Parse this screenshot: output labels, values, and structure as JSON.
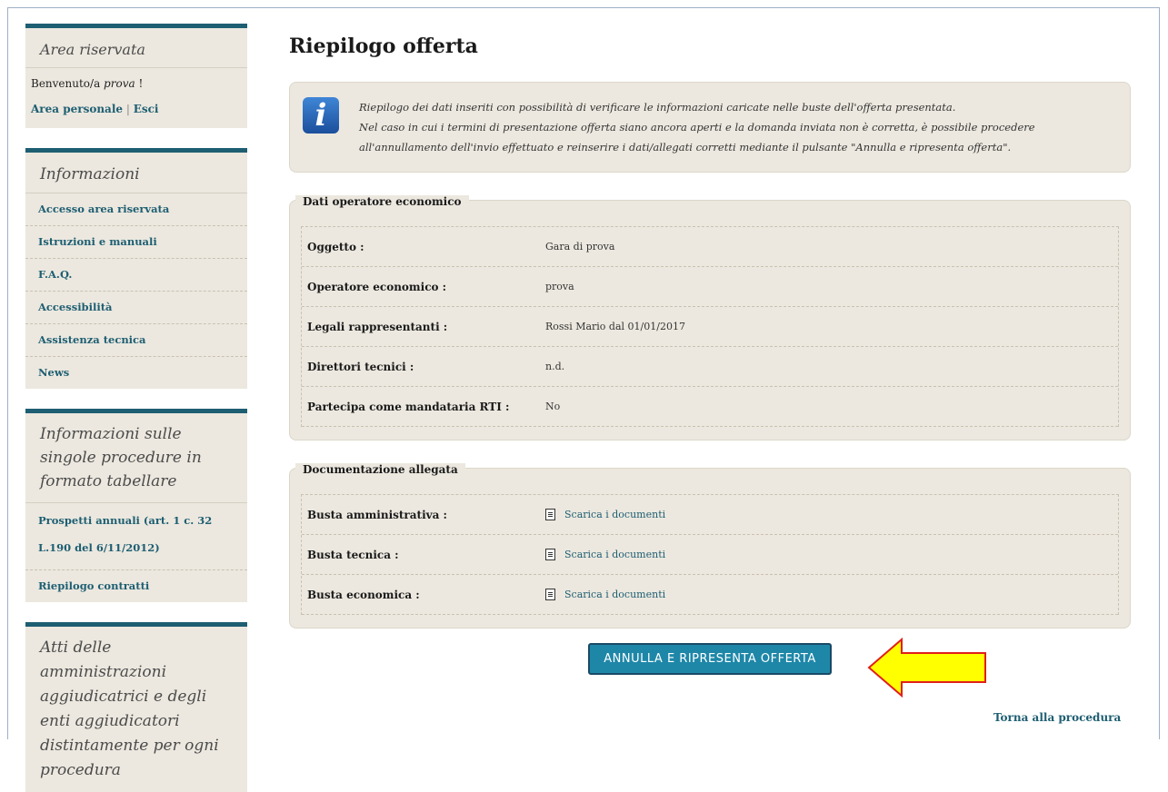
{
  "sidebar": {
    "area_title": "Area riservata",
    "welcome_prefix": "Benvenuto/a ",
    "welcome_user": "prova",
    "welcome_suffix": " !",
    "area_personale": "Area personale",
    "separator": " | ",
    "esci": "Esci",
    "info_title": "Informazioni",
    "info_items": [
      "Accesso area riservata",
      "Istruzioni e manuali",
      "F.A.Q.",
      "Accessibilità",
      "Assistenza tecnica",
      "News"
    ],
    "tabular_title": "Informazioni sulle singole procedure in formato tabellare",
    "tabular_items": [
      "Prospetti annuali (art. 1 c. 32 L.190 del 6/11/2012)",
      "Riepilogo contratti"
    ],
    "atti_title": "Atti delle amministrazioni aggiudicatrici e degli enti aggiudicatori distintamente per ogni procedura"
  },
  "main": {
    "title": "Riepilogo offerta",
    "info_icon": "i",
    "info_line1": "Riepilogo dei dati inseriti con possibilità di verificare le informazioni caricate nelle buste dell'offerta presentata.",
    "info_line2": "Nel caso in cui i termini di presentazione offerta siano ancora aperti e la domanda inviata non è corretta, è possibile procedere all'annullamento dell'invio effettuato e reinserire i dati/allegati corretti mediante il pulsante \"Annulla e ripresenta offerta\".",
    "operatore": {
      "legend": "Dati operatore economico",
      "rows": [
        {
          "label": "Oggetto :",
          "value": "Gara di prova"
        },
        {
          "label": "Operatore economico :",
          "value": "prova"
        },
        {
          "label": "Legali rappresentanti :",
          "value": "Rossi Mario dal 01/01/2017"
        },
        {
          "label": "Direttori tecnici :",
          "value": "n.d."
        },
        {
          "label": "Partecipa come mandataria RTI :",
          "value": "No"
        }
      ]
    },
    "documentazione": {
      "legend": "Documentazione allegata",
      "rows": [
        {
          "label": "Busta amministrativa :",
          "link": "Scarica i documenti"
        },
        {
          "label": "Busta tecnica :",
          "link": "Scarica i documenti"
        },
        {
          "label": "Busta economica :",
          "link": "Scarica i documenti"
        }
      ]
    },
    "button": "ANNULLA E RIPRESENTA OFFERTA",
    "back": "Torna alla procedura"
  },
  "colors": {
    "accent": "#1d5e72",
    "panel": "#ece8df",
    "button": "#1e87a8",
    "arrow": "#ffff00"
  }
}
